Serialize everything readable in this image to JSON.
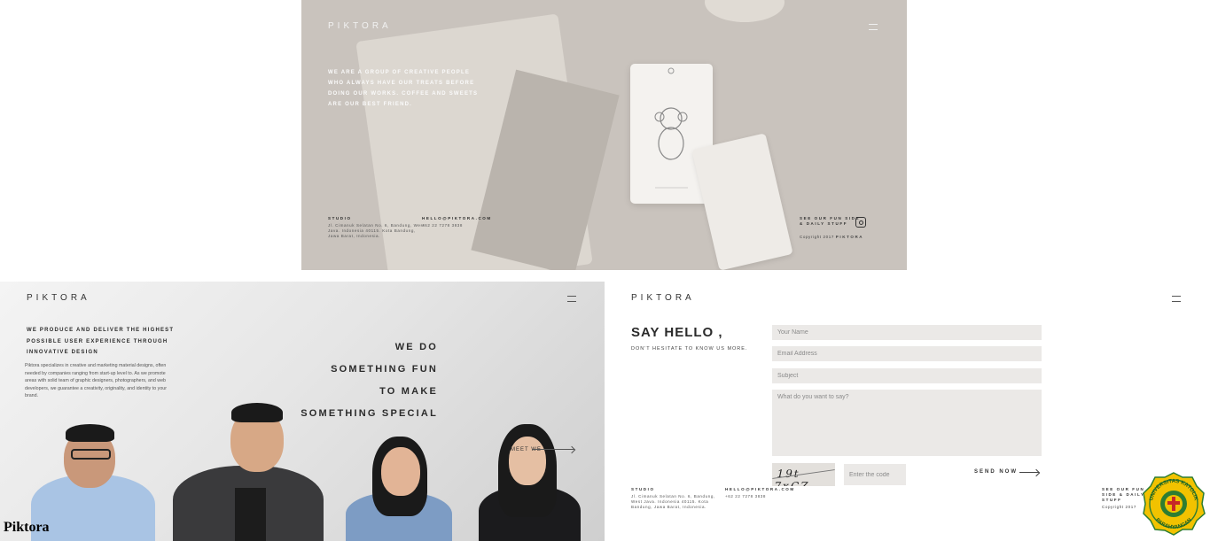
{
  "top_panel": {
    "brand": "PIKTORA",
    "intro": "WE ARE A GROUP OF CREATIVE PEOPLE WHO ALWAYS HAVE OUR TREATS BEFORE DOING OUR WORKS. COFFEE AND SWEETS ARE OUR BEST FRIEND.",
    "studio_label": "STUDIO",
    "studio_address": "Jl. Cimanuk Selatan No. 6, Bandung, West Java. Indonesia 40115. Kota Bandung, Jawa Barat, Indonesia.",
    "email": "HELLO@PIKTORA.COM",
    "phone": "+62 22 7278 3838",
    "follow": "SEE OUR FUN SIDE & DAILY STUFF",
    "copyright": "Copyright 2017",
    "copyright_brand": "PIKTORA"
  },
  "about_panel": {
    "brand": "PIKTORA",
    "headline": "WE PRODUCE AND DELIVER THE HIGHEST POSSIBLE USER EXPERIENCE THROUGH INNOVATIVE DESIGN",
    "description": "Piktora specializes in creative and marketing material designs, often needed by companies ranging from start-up level to. As we promote areas with solid team of graphic designers, photographers, and web developers, we guarantee a creativity, originality, and identity to your brand.",
    "tagline": [
      "WE DO",
      "SOMETHING FUN",
      "TO MAKE",
      "SOMETHING SPECIAL"
    ],
    "meet_label": "MEET WE"
  },
  "contact_panel": {
    "brand": "PIKTORA",
    "title": "SAY HELLO ,",
    "subtitle": "DON'T HESITATE TO KNOW US MORE.",
    "name_placeholder": "Your Name",
    "email_placeholder": "Email Address",
    "subject_placeholder": "Subject",
    "message_placeholder": "What do you want to say?",
    "captcha_text": "19t 7xCZ",
    "code_placeholder": "Enter the code",
    "send_label": "SEND NOW",
    "studio_label": "STUDIO",
    "studio_address": "Jl. Cimanuk Selatan No. 6, Bandung, West Java. Indonesia 40115. Kota Bandung, Jawa Barat, Indonesia.",
    "email": "HELLO@PIKTORA.COM",
    "phone": "+62 22 7278 3838",
    "follow": "SEE OUR FUN SIDE & DAILY STUFF",
    "copyright": "Copyright 2017"
  },
  "overlay": {
    "caption": "Piktora",
    "seal_text_top": "UNIVERSITAS KATOLIK",
    "seal_text_bottom": "PARAHYANGAN"
  },
  "colors": {
    "top_bg": "#c9c3bd",
    "text_dark": "#2b2b2b",
    "field_bg": "#ebe9e7",
    "seal_green": "#2e7d32",
    "seal_yellow": "#f2c200"
  }
}
